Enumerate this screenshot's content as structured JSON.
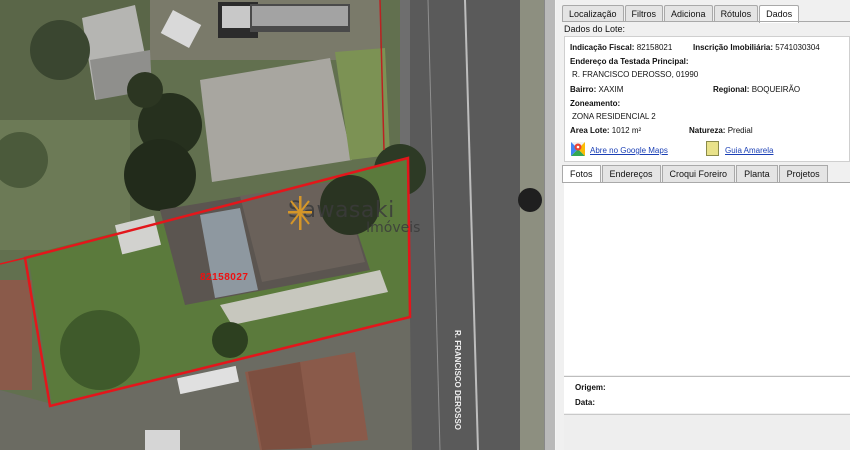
{
  "map": {
    "parcel_label": "82158027",
    "street_label": "R. FRANCISCO DEROSSO",
    "watermark_main": "Sawasaki",
    "watermark_sub": "Imóveis",
    "boundary_color": "#e3161b"
  },
  "panel": {
    "tabs": [
      "Localização",
      "Filtros",
      "Adiciona",
      "Rótulos",
      "Dados"
    ],
    "active_tab": "Dados",
    "section_title": "Dados do Lote:",
    "fields": {
      "indicacao_fiscal_label": "Indicação Fiscal:",
      "indicacao_fiscal_value": "82158021",
      "inscricao_label": "Inscrição Imobiliária:",
      "inscricao_value": "5741030304",
      "endereco_label": "Endereço da Testada Principal:",
      "endereco_value": "R. FRANCISCO DEROSSO, 01990",
      "bairro_label": "Bairro:",
      "bairro_value": "XAXIM",
      "regional_label": "Regional:",
      "regional_value": "BOQUEIRÃO",
      "zoneamento_label": "Zoneamento:",
      "zoneamento_value": "ZONA RESIDENCIAL 2",
      "area_label": "Area Lote:",
      "area_value": "1012 m²",
      "natureza_label": "Natureza:",
      "natureza_value": "Predial"
    },
    "links": {
      "google_maps": "Abre no Google Maps",
      "guia_amarela": "Guia Amarela"
    },
    "tabs2": [
      "Fotos",
      "Endereços",
      "Croqui Foreiro",
      "Planta",
      "Projetos"
    ],
    "active_tab2": "Fotos",
    "meta": {
      "origem_label": "Origem:",
      "data_label": "Data:"
    }
  },
  "icons": [
    "google-maps-icon",
    "guia-amarela-icon",
    "watermark-star-icon"
  ]
}
